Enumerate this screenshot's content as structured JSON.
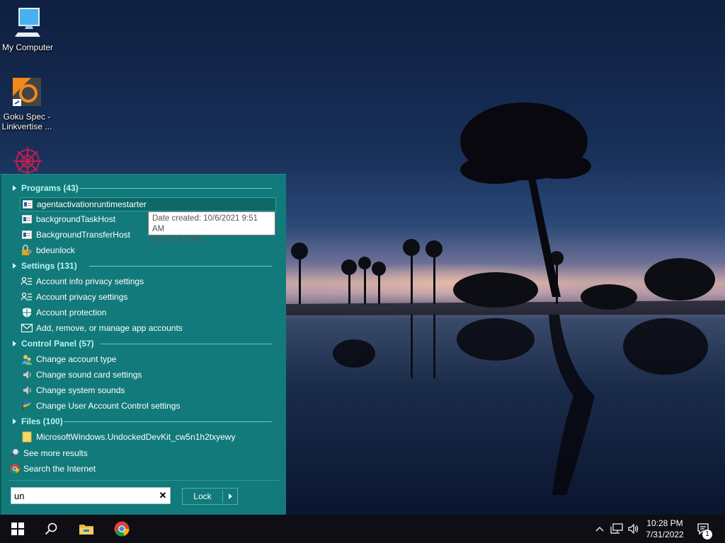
{
  "desktop": {
    "icons": [
      {
        "label": "My Computer",
        "icon": "computer-icon"
      },
      {
        "label": "Goku Spec - Linkvertise ...",
        "icon": "app-shortcut-icon"
      },
      {
        "label": "",
        "icon": "mandala-app-icon"
      }
    ]
  },
  "menu": {
    "sections": {
      "programs": "Programs (43)",
      "settings": "Settings (131)",
      "control_panel": "Control Panel (57)",
      "files": "Files (100)"
    },
    "programs": [
      {
        "label": "agentactivationruntimestarter",
        "icon": "window-app-icon",
        "selected": true
      },
      {
        "label": "backgroundTaskHost",
        "icon": "window-app-icon"
      },
      {
        "label": "BackgroundTransferHost",
        "icon": "window-app-icon"
      },
      {
        "label": "bdeunlock",
        "icon": "key-lock-icon"
      }
    ],
    "settings": [
      {
        "label": "Account info privacy settings",
        "icon": "person-list-icon"
      },
      {
        "label": "Account privacy settings",
        "icon": "person-list-icon"
      },
      {
        "label": "Account protection",
        "icon": "shield-icon"
      },
      {
        "label": "Add, remove, or manage app accounts",
        "icon": "envelope-icon"
      }
    ],
    "control_panel": [
      {
        "label": "Change account type",
        "icon": "users-icon"
      },
      {
        "label": "Change sound card settings",
        "icon": "speaker-icon"
      },
      {
        "label": "Change system sounds",
        "icon": "speaker-icon"
      },
      {
        "label": "Change User Account Control settings",
        "icon": "uac-flag-icon"
      }
    ],
    "files": [
      {
        "label": "MicrosoftWindows.UndockedDevKit_cw5n1h2txyewy",
        "icon": "folder-icon"
      }
    ],
    "see_more": "See more results",
    "search_internet": "Search the Internet",
    "tooltip": {
      "line1": "Date created: 10/6/2021 9:51 AM",
      "line2": "Size: 13.0 KB"
    },
    "search_value": "un",
    "lock_label": "Lock"
  },
  "taskbar": {
    "time": "10:28 PM",
    "date": "7/31/2022",
    "notification_count": "1",
    "pinned": [
      "windows-start-icon",
      "search-icon",
      "file-explorer-icon",
      "chrome-icon"
    ]
  },
  "colors": {
    "menu_bg": "#127a7a",
    "section_text": "#b9f4f4",
    "taskbar_bg": "#0e0e14"
  }
}
